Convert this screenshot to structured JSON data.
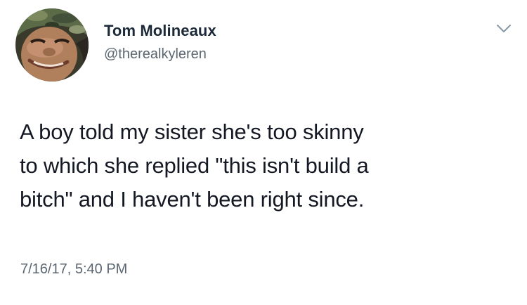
{
  "author": {
    "name": "Tom Molineaux",
    "handle": "@therealkyleren"
  },
  "tweet": {
    "text": "A boy told my sister she's too skinny\nto which she replied \"this isn't build a\nbitch\" and I haven't been right since.",
    "timestamp": "7/16/17, 5:40 PM"
  },
  "icons": {
    "avatar": "avatar-photo",
    "menu": "chevron-down-icon"
  },
  "colors": {
    "text": "#141823",
    "name": "#1c2938",
    "secondary": "#5b6670",
    "background": "#ffffff"
  }
}
